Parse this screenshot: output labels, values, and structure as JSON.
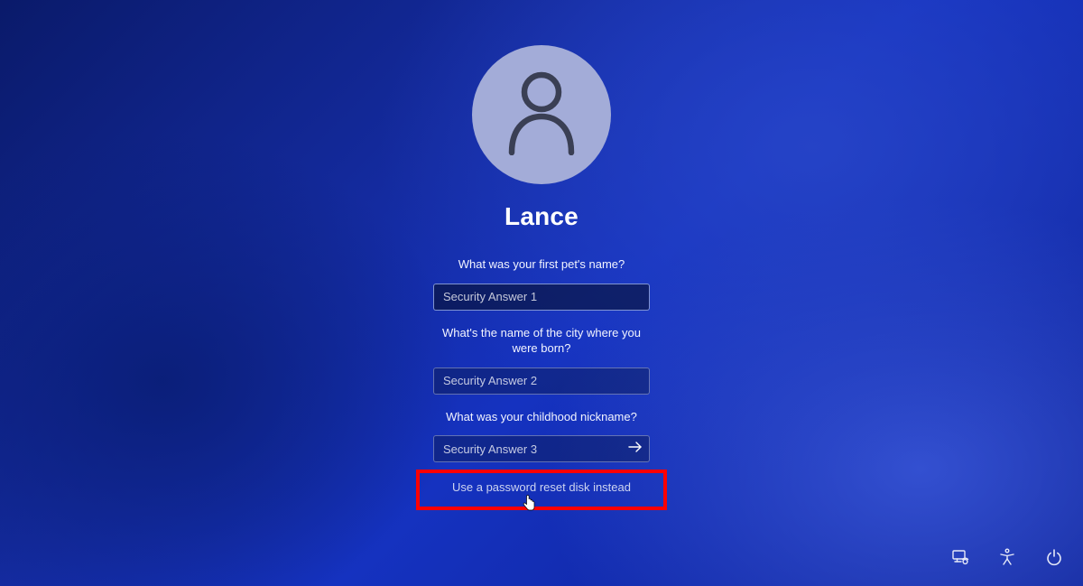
{
  "user": {
    "name": "Lance"
  },
  "questions": {
    "q1": "What was your first pet's name?",
    "q2": "What's the name of the city where you were born?",
    "q3": "What was your childhood nickname?"
  },
  "placeholders": {
    "a1": "Security Answer 1",
    "a2": "Security Answer 2",
    "a3": "Security Answer 3"
  },
  "links": {
    "reset_disk": "Use a password reset disk instead"
  }
}
